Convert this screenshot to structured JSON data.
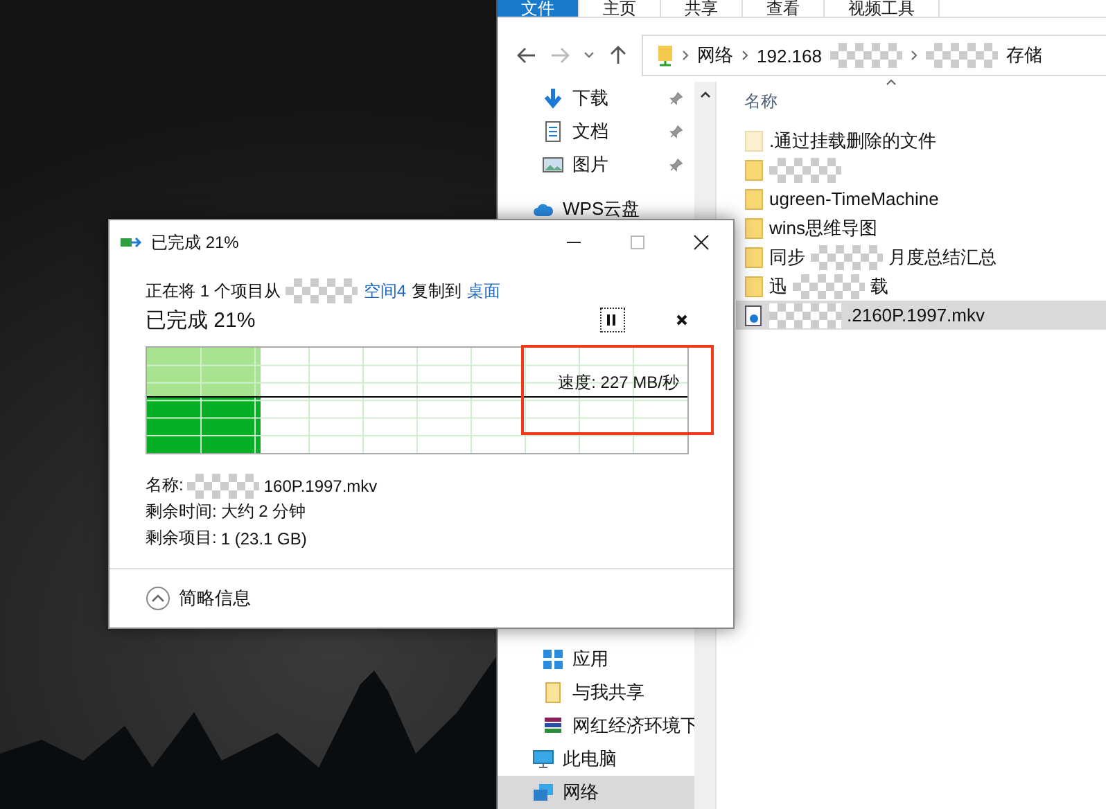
{
  "explorer": {
    "ribbon_tabs": [
      {
        "label": "文件",
        "selected": true
      },
      {
        "label": "主页",
        "selected": false
      },
      {
        "label": "共享",
        "selected": false
      },
      {
        "label": "查看",
        "selected": false
      },
      {
        "label": "视频工具",
        "selected": false
      }
    ],
    "breadcrumb": [
      {
        "start": "网络",
        "redacted": false
      },
      {
        "start": "192.168",
        "redacted": true
      },
      {
        "redacted": true,
        "end": "存储"
      }
    ],
    "nav_top": [
      {
        "label": "下载",
        "kind": "download",
        "pinned": true
      },
      {
        "label": "文档",
        "kind": "document",
        "pinned": true
      },
      {
        "label": "图片",
        "kind": "picture",
        "pinned": true
      },
      {
        "label": "WPS云盘",
        "kind": "cloud",
        "pinned": false
      }
    ],
    "nav_bottom": [
      {
        "label": "应用",
        "kind": "apps",
        "selected": false
      },
      {
        "label": "与我共享",
        "kind": "folder",
        "selected": false
      },
      {
        "label": "网红经济环境下",
        "kind": "archive",
        "selected": false
      },
      {
        "label": "此电脑",
        "kind": "computer",
        "selected": false
      },
      {
        "label": "网络",
        "kind": "network",
        "selected": true
      }
    ],
    "column_header": "名称",
    "files": [
      {
        "start": ".通过挂载删除的文件",
        "redacted": false,
        "kind": "hidden-folder",
        "selected": false
      },
      {
        "redacted": true,
        "kind": "folder",
        "selected": false
      },
      {
        "start": "ugreen-TimeMachine",
        "redacted": false,
        "kind": "folder",
        "selected": false
      },
      {
        "start": "wins思维导图",
        "redacted": false,
        "kind": "folder",
        "selected": false
      },
      {
        "start": "同步",
        "redacted": true,
        "end": "月度总结汇总",
        "kind": "folder",
        "selected": false
      },
      {
        "start": "迅",
        "redacted": true,
        "end": "载",
        "kind": "folder",
        "selected": false
      },
      {
        "redacted": true,
        "end": ".2160P.1997.mkv",
        "kind": "video",
        "selected": true
      }
    ]
  },
  "dialog": {
    "title": "已完成 21%",
    "status": [
      {
        "kind": "text",
        "text": "正在将 1 个项目从"
      },
      {
        "kind": "redacted"
      },
      {
        "kind": "link",
        "text": "空间4"
      },
      {
        "kind": "text",
        "text": "复制到"
      },
      {
        "kind": "link",
        "text": "桌面"
      }
    ],
    "heading": "已完成 21%",
    "level": 0.21,
    "speed": "速度: 227 MB/秒",
    "details": [
      {
        "label": "名称:",
        "redacted": true,
        "value": "160P.1997.mkv"
      },
      {
        "label": "剩余时间:",
        "redacted": false,
        "value": "大约 2 分钟"
      },
      {
        "label": "剩余项目:",
        "redacted": false,
        "value": "1 (23.1 GB)"
      }
    ],
    "footer": "简略信息"
  }
}
